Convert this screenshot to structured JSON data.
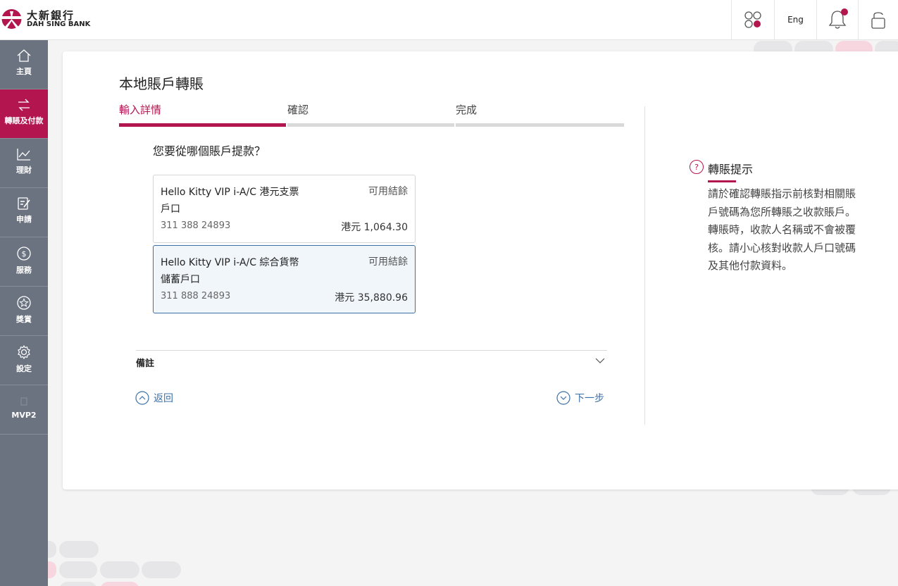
{
  "brand": {
    "name_cn": "大新銀行",
    "name_en": "DAH SING BANK",
    "color": "#b3154f"
  },
  "topbar": {
    "apps_icon": "apps-grid-icon",
    "language": "Eng",
    "notification_icon": "bell-icon",
    "logout_icon": "lock-icon"
  },
  "sidebar": {
    "items": [
      {
        "label": "主頁",
        "icon": "home-icon"
      },
      {
        "label": "轉賬及付款",
        "icon": "transfer-icon",
        "active": true
      },
      {
        "label": "理財",
        "icon": "chart-icon"
      },
      {
        "label": "申請",
        "icon": "form-edit-icon"
      },
      {
        "label": "服務",
        "icon": "dollar-icon"
      },
      {
        "label": "獎賞",
        "icon": "star-icon"
      },
      {
        "label": "設定",
        "icon": "gear-icon"
      },
      {
        "label": "MVP2",
        "icon": "placeholder-icon"
      }
    ]
  },
  "main": {
    "title": "本地賬戶轉賬",
    "steps": [
      {
        "label": "輸入詳情",
        "active": true
      },
      {
        "label": "確認",
        "active": false
      },
      {
        "label": "完成",
        "active": false
      }
    ],
    "question": "您要從哪個賬戶提款？",
    "accounts": [
      {
        "name": "Hello Kitty VIP i-A/C 港元支票戶口",
        "number": "311 388 24893",
        "balance_label": "可用結餘",
        "balance": "港元 1,064.30",
        "selected": false
      },
      {
        "name": "Hello Kitty VIP i-A/C 綜合貨幣儲蓄戶口",
        "number": "311 888 24893",
        "balance_label": "可用結餘",
        "balance": "港元 35,880.96",
        "selected": true
      }
    ],
    "remark_label": "備註",
    "back_label": "返回",
    "next_label": "下一步"
  },
  "tips": {
    "title": "轉賬提示",
    "body": "請於確認轉賬指示前核對相關賬戶號碼為您所轉賬之收款賬戶。轉賬時，收款人名稱或不會被覆核。請小心核對收款人戶口號碼及其他付款資料。"
  }
}
